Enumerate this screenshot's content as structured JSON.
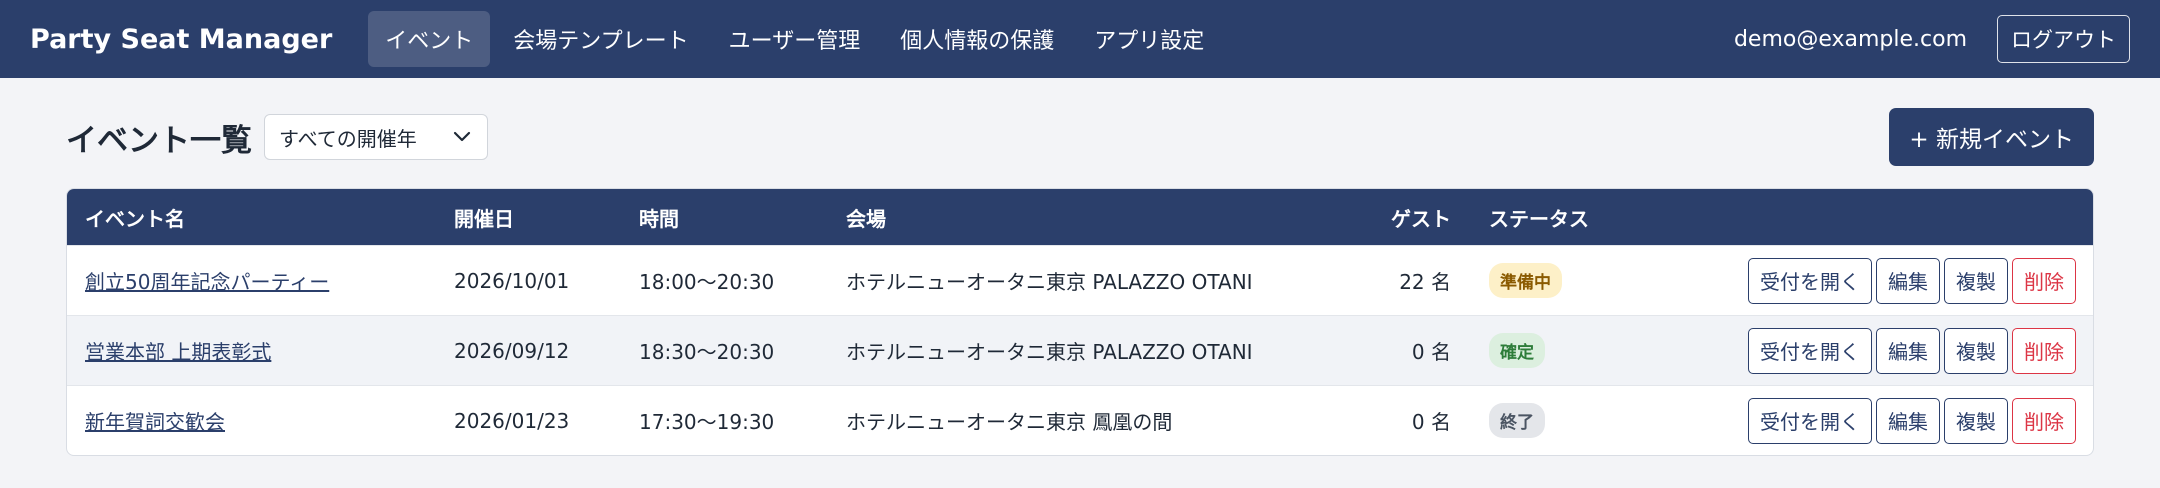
{
  "nav": {
    "brand": "Party Seat Manager",
    "links": [
      {
        "label": "イベント",
        "active": true
      },
      {
        "label": "会場テンプレート",
        "active": false
      },
      {
        "label": "ユーザー管理",
        "active": false
      },
      {
        "label": "個人情報の保護",
        "active": false
      },
      {
        "label": "アプリ設定",
        "active": false
      }
    ],
    "user_email": "demo@example.com",
    "logout_label": "ログアウト"
  },
  "page": {
    "title": "イベント一覧",
    "year_filter": {
      "selected": "すべての開催年",
      "icon": "chevron-down-icon"
    },
    "new_event_label": "+ 新規イベント"
  },
  "table": {
    "columns": [
      "イベント名",
      "開催日",
      "時間",
      "会場",
      "ゲスト",
      "ステータス"
    ],
    "rows": [
      {
        "name": "創立50周年記念パーティー",
        "date": "2026/10/01",
        "time": "18:00〜20:30",
        "venue": "ホテルニューオータニ東京 PALAZZO OTANI",
        "guests": "22 名",
        "status": "準備中",
        "status_key": "preparing"
      },
      {
        "name": "営業本部 上期表彰式",
        "date": "2026/09/12",
        "time": "18:30〜20:30",
        "venue": "ホテルニューオータニ東京 PALAZZO OTANI",
        "guests": "0 名",
        "status": "確定",
        "status_key": "confirmed"
      },
      {
        "name": "新年賀詞交歓会",
        "date": "2026/01/23",
        "time": "17:30〜19:30",
        "venue": "ホテルニューオータニ東京 鳳凰の間",
        "guests": "0 名",
        "status": "終了",
        "status_key": "finished"
      }
    ],
    "actions": {
      "open_reception": "受付を開く",
      "edit": "編集",
      "duplicate": "複製",
      "delete": "削除"
    }
  },
  "colors": {
    "primary": "#2b3f6b",
    "danger": "#dc3545",
    "status": {
      "preparing": {
        "bg": "#fdf0c8",
        "fg": "#8a5a00"
      },
      "confirmed": {
        "bg": "#dcefdf",
        "fg": "#2e7d3a"
      },
      "finished": {
        "bg": "#e4e6ea",
        "fg": "#4b5563"
      }
    }
  }
}
